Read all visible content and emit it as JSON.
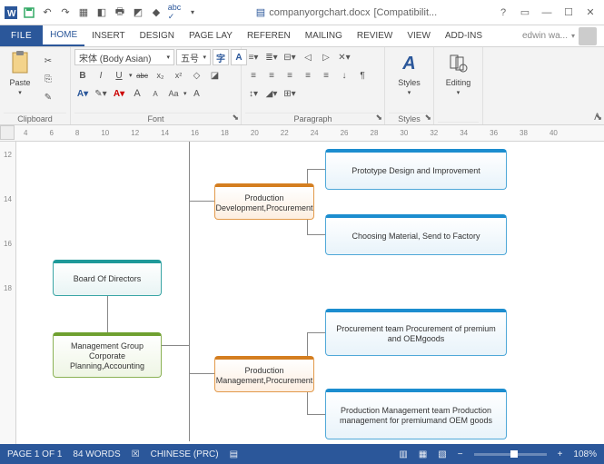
{
  "titlebar": {
    "word_icon": "W",
    "filename": "companyorgchart.docx",
    "suffix": "[Compatibilit...",
    "help": "?"
  },
  "tabs": {
    "file": "FILE",
    "home": "HOME",
    "insert": "INSERT",
    "design": "DESIGN",
    "pagelayout": "PAGE LAY",
    "references": "REFEREN",
    "mailings": "MAILING",
    "review": "REVIEW",
    "view": "VIEW",
    "addins": "ADD-INS",
    "user": "edwin wa..."
  },
  "ribbon": {
    "clipboard": {
      "label": "Clipboard",
      "paste": "Paste"
    },
    "font": {
      "label": "Font",
      "name": "宋体 (Body Asian)",
      "size": "五号",
      "bold": "B",
      "italic": "I",
      "underline": "U",
      "strike": "abc",
      "sub": "x₂",
      "sup": "x²",
      "grow": "A",
      "shrink": "A",
      "case": "Aa",
      "clear": "◢"
    },
    "paragraph": {
      "label": "Paragraph"
    },
    "styles": {
      "label": "Styles",
      "btn": "Styles"
    },
    "editing": {
      "label": "Editing",
      "btn": "Editing"
    }
  },
  "ruler_h": [
    "4",
    "6",
    "8",
    "10",
    "12",
    "14",
    "16",
    "18",
    "20",
    "22",
    "24",
    "26",
    "28",
    "30",
    "32",
    "34",
    "36",
    "38",
    "40"
  ],
  "ruler_v": [
    "12",
    "14",
    "16",
    "18"
  ],
  "org": {
    "board": "Board Of Directors",
    "mgmt": "Management Group Corporate Planning,Accounting",
    "proddev": "Production Development,Procurement",
    "prodmgmt": "Production Management,Procurement",
    "proto": "Prototype Design and Improvement",
    "material": "Choosing Material, Send to Factory",
    "procteam": "Procurement team Procurement of premium and OEMgoods",
    "pmteam": "Production Management team Production management for premiumand OEM goods"
  },
  "status": {
    "page": "PAGE 1 OF 1",
    "words": "84 WORDS",
    "lang": "CHINESE (PRC)",
    "zoom": "108%"
  }
}
